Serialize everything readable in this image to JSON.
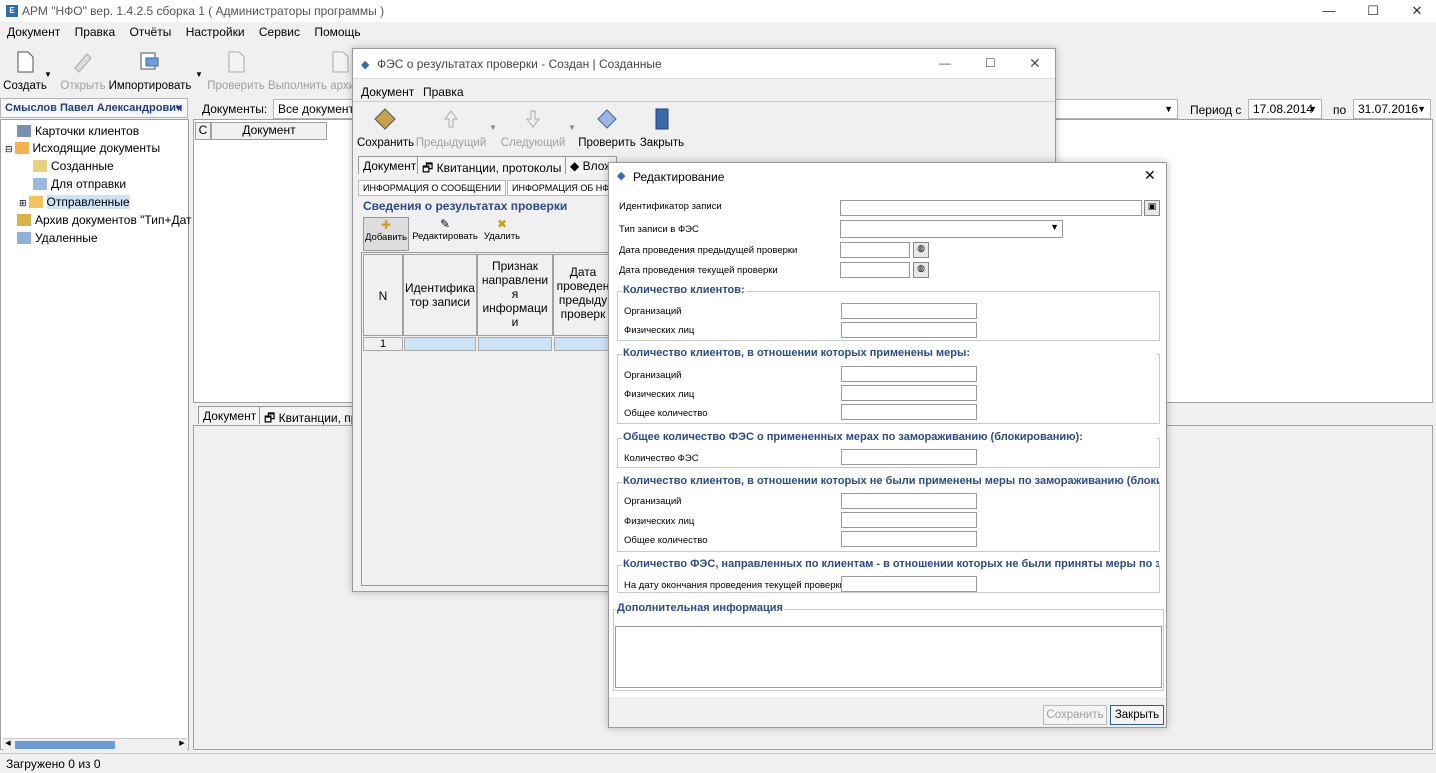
{
  "app": {
    "title": "АРМ \"НФО\" вер. 1.4.2.5 сборка 1 ( Администраторы программы )",
    "icon_letter": "E"
  },
  "menu": [
    "Документ",
    "Правка",
    "Отчёты",
    "Настройки",
    "Сервис",
    "Помощь"
  ],
  "toolbar": {
    "create": "Создать",
    "open": "Открыть",
    "import": "Импортировать",
    "check": "Проверить",
    "execute": "Выполнить архи"
  },
  "user_combo": "Смыслов Павел Александрович",
  "filter": {
    "docs_label": "Документы:",
    "docs_value": "Все документы",
    "period_from_label": "Период с",
    "period_from": "17.08.2014",
    "period_to_label": "по",
    "period_to": "31.07.2016"
  },
  "tree": [
    {
      "label": "Карточки клиентов",
      "indent": 0
    },
    {
      "label": "Исходящие документы",
      "indent": 0
    },
    {
      "label": "Созданные",
      "indent": 1
    },
    {
      "label": "Для отправки",
      "indent": 1
    },
    {
      "label": "Отправленные",
      "indent": 1,
      "selected": true
    },
    {
      "label": "Архив документов \"Тип+Дат",
      "indent": 0
    },
    {
      "label": "Удаленные",
      "indent": 0
    }
  ],
  "main_grid": {
    "col_c": "С",
    "col_doc": "Документ"
  },
  "bottom_tabs": [
    "Документ",
    "Квитанции, пр"
  ],
  "status": "Загружено 0 из 0",
  "fes_window": {
    "title": "ФЭС о результатах проверки - Создан | Созданные",
    "menu": [
      "Документ",
      "Правка"
    ],
    "toolbar": {
      "save": "Сохранить",
      "prev": "Предыдущий",
      "next": "Следующий",
      "check": "Проверить",
      "close": "Закрыть"
    },
    "tabs": [
      "Документ",
      "Квитанции, протоколы",
      "Влож"
    ],
    "subtabs": [
      "ИНФОРМАЦИЯ О СООБЩЕНИИ",
      "ИНФОРМАЦИЯ ОБ НФО"
    ],
    "section_title": "Сведения о результатах проверки",
    "mini_toolbar": {
      "add": "Добавить",
      "edit": "Редактировать",
      "delete": "Удалить"
    },
    "grid_headers": [
      "N",
      "Идентифика тор записи",
      "Признак направлени я информаци и",
      "Дата проведен предыду проверк"
    ],
    "grid_row": "1"
  },
  "edit_dialog": {
    "title": "Редактирование",
    "close": "✕",
    "fields": {
      "record_id": "Идентификатор записи",
      "record_type": "Тип записи в ФЭС",
      "prev_check_date": "Дата проведения предыдущей проверки",
      "curr_check_date": "Дата проведения текущей проверки"
    },
    "group1": {
      "title": "Количество клиентов:",
      "org": "Организаций",
      "phys": "Физических лиц"
    },
    "group2": {
      "title": "Количество клиентов, в отношении которых применены меры:",
      "org": "Организаций",
      "phys": "Физических лиц",
      "total": "Общее количество"
    },
    "group3": {
      "title": "Общее количество ФЭС о примененных мерах по замораживанию (блокированию):",
      "count": "Количество ФЭС"
    },
    "group4": {
      "title": "Количество клиентов, в отношении которых не были применены меры по замораживанию (блоки",
      "org": "Организаций",
      "phys": "Физических лиц",
      "total": "Общее количество"
    },
    "group5": {
      "title": "Количество ФЭС, направленных по клиентам - в отношении которых не были приняты меры по за",
      "date": "На дату окончания проведения текущей проверки"
    },
    "group6": {
      "title": "Дополнительная информация"
    },
    "save_btn": "Сохранить",
    "close_btn": "Закрыть"
  }
}
